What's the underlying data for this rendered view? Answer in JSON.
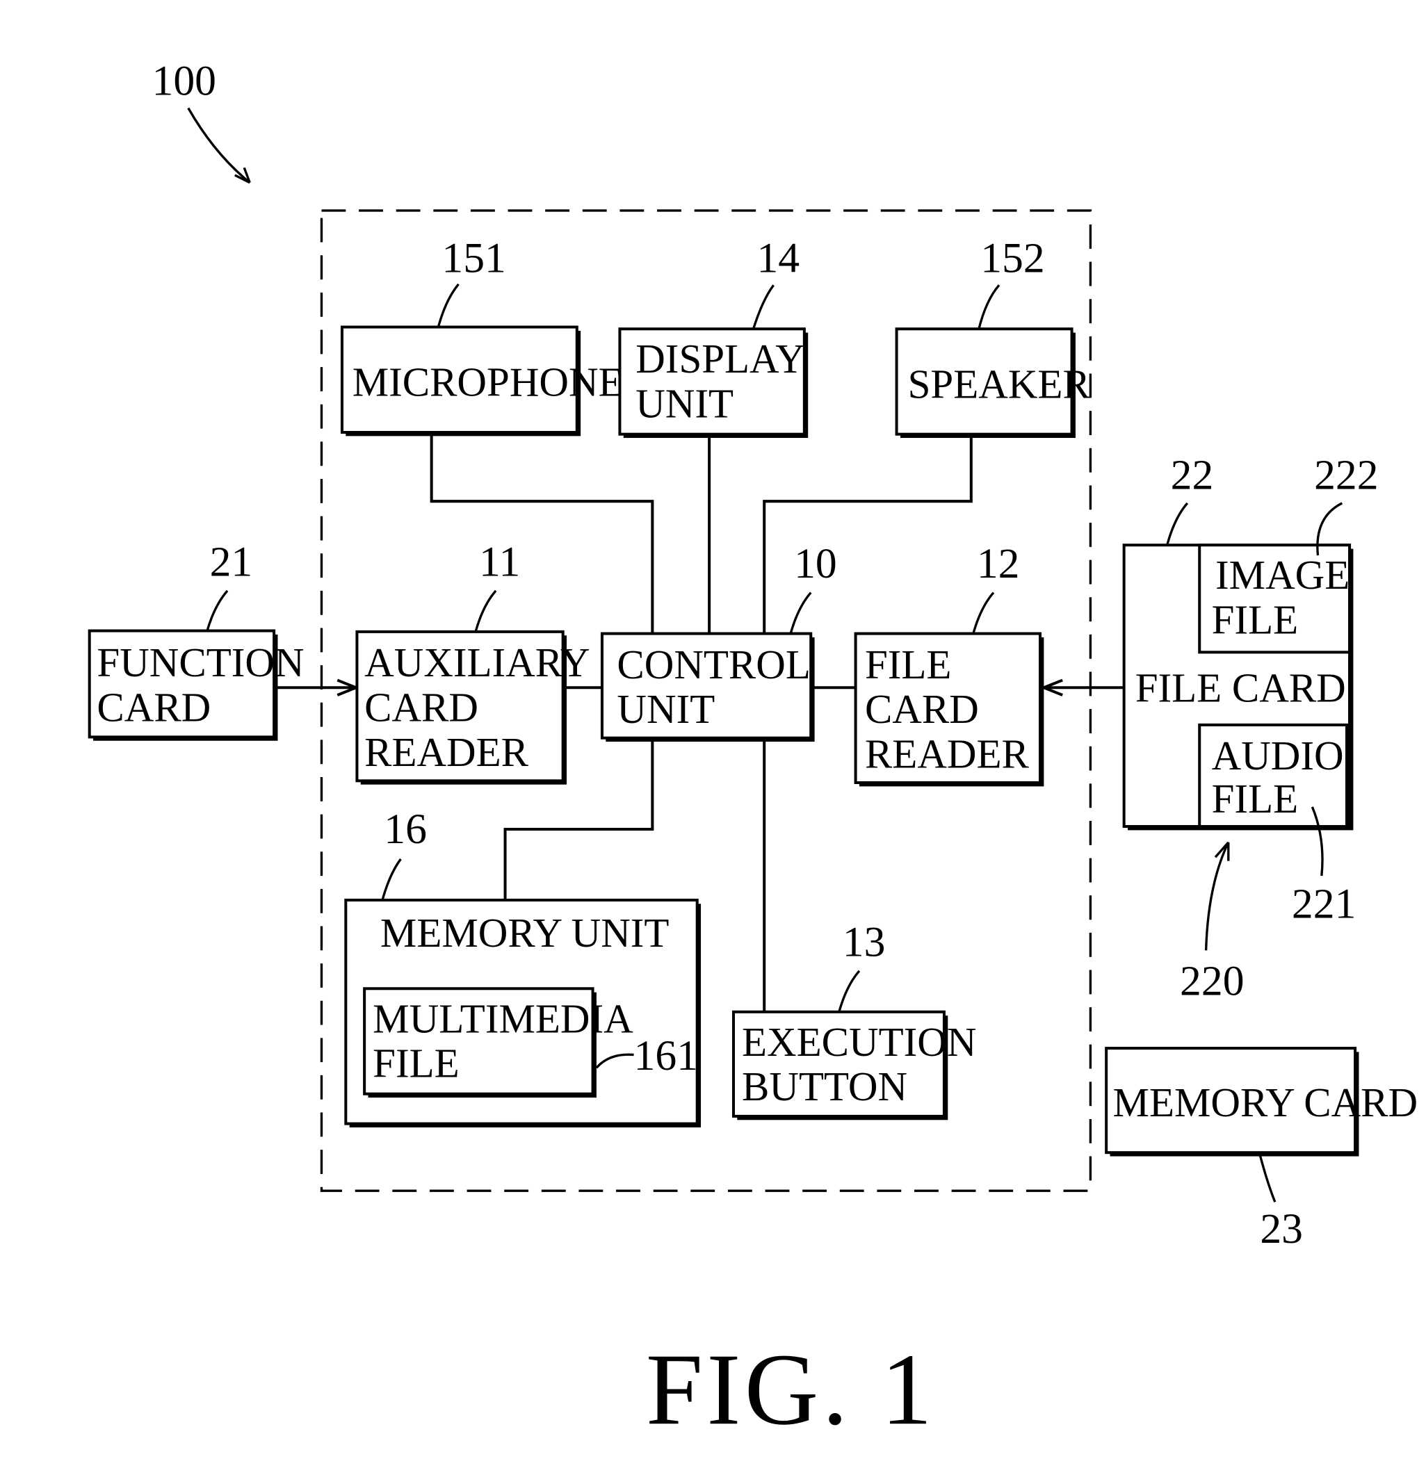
{
  "figure": {
    "title": "FIG. 1",
    "system_ref": "100"
  },
  "blocks": {
    "microphone": {
      "label_lines": [
        "MICROPHONE"
      ],
      "ref": "151"
    },
    "display_unit": {
      "label_lines": [
        "DISPLAY",
        "UNIT"
      ],
      "ref": "14"
    },
    "speaker": {
      "label_lines": [
        "SPEAKER"
      ],
      "ref": "152"
    },
    "function_card": {
      "label_lines": [
        "FUNCTION",
        "CARD"
      ],
      "ref": "21"
    },
    "auxiliary_card_reader": {
      "label_lines": [
        "AUXILIARY",
        "CARD",
        "READER"
      ],
      "ref": "11"
    },
    "control_unit": {
      "label_lines": [
        "CONTROL",
        "UNIT"
      ],
      "ref": "10"
    },
    "file_card_reader": {
      "label_lines": [
        "FILE",
        "CARD",
        "READER"
      ],
      "ref": "12"
    },
    "file_card": {
      "label_lines": [
        "FILE  CARD"
      ],
      "ref": "22",
      "group_ref": "220"
    },
    "image_file": {
      "label_lines": [
        "IMAGE",
        "FILE"
      ],
      "ref": "222"
    },
    "audio_file": {
      "label_lines": [
        "AUDIO",
        "FILE"
      ],
      "ref": "221"
    },
    "memory_unit": {
      "label_lines": [
        "MEMORY  UNIT"
      ],
      "ref": "16"
    },
    "multimedia_file": {
      "label_lines": [
        "MULTIMEDIA",
        "FILE"
      ],
      "ref": "161"
    },
    "execution_button": {
      "label_lines": [
        "EXECUTION",
        "BUTTON"
      ],
      "ref": "13"
    },
    "memory_card": {
      "label_lines": [
        "MEMORY  CARD"
      ],
      "ref": "23"
    }
  }
}
